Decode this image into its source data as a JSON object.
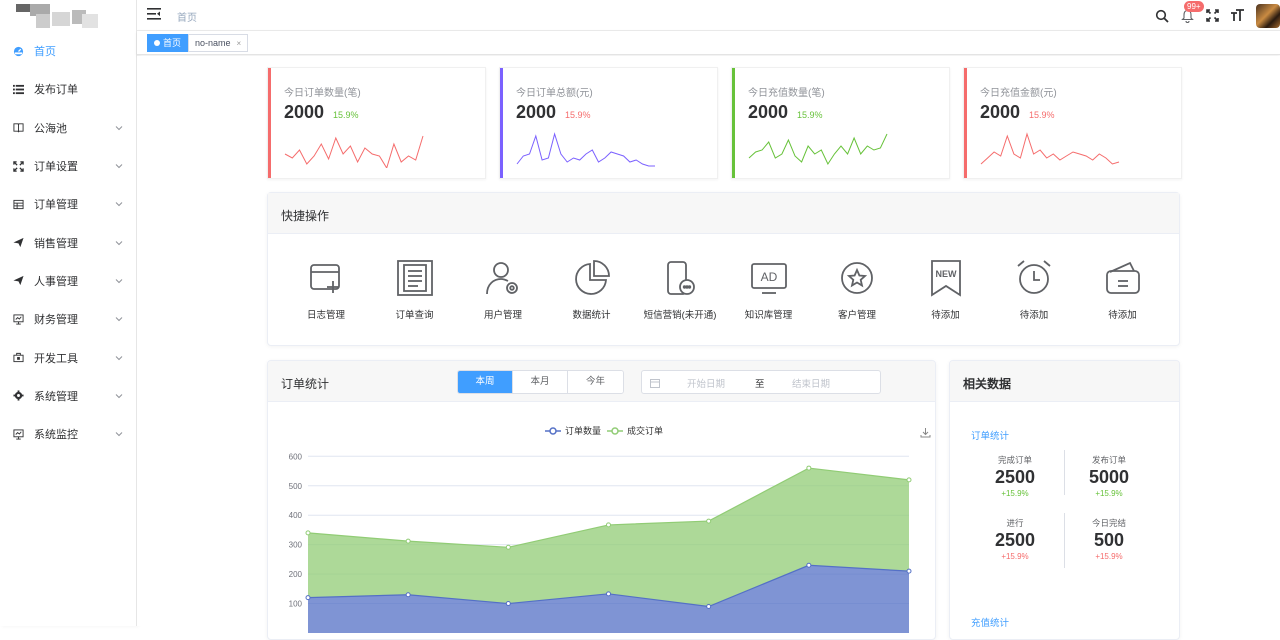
{
  "sidebar": {
    "items": [
      {
        "label": "首页",
        "icon": "dashboard-icon",
        "active": true,
        "has_children": false
      },
      {
        "label": "发布订单",
        "icon": "list-icon",
        "active": false,
        "has_children": false
      },
      {
        "label": "公海池",
        "icon": "book-icon",
        "active": false,
        "has_children": true
      },
      {
        "label": "订单设置",
        "icon": "fullscreen-icon",
        "active": false,
        "has_children": true
      },
      {
        "label": "订单管理",
        "icon": "table-icon",
        "active": false,
        "has_children": true
      },
      {
        "label": "销售管理",
        "icon": "send-icon",
        "active": false,
        "has_children": true
      },
      {
        "label": "人事管理",
        "icon": "send-icon",
        "active": false,
        "has_children": true
      },
      {
        "label": "财务管理",
        "icon": "monitor-chart-icon",
        "active": false,
        "has_children": true
      },
      {
        "label": "开发工具",
        "icon": "toolbox-icon",
        "active": false,
        "has_children": true
      },
      {
        "label": "系统管理",
        "icon": "gear-icon",
        "active": false,
        "has_children": true
      },
      {
        "label": "系统监控",
        "icon": "monitor-icon",
        "active": false,
        "has_children": true
      }
    ]
  },
  "header": {
    "breadcrumb": "首页",
    "notification_badge": "99+"
  },
  "tags": {
    "active_label": "首页",
    "second_label": "no-name",
    "close_glyph": "×"
  },
  "stats": [
    {
      "title": "今日订单数量(笔)",
      "value": "2000",
      "pct": "15.9%",
      "bar_color": "#f56c6c",
      "pct_color": "#67c23a",
      "spark_color": "#f56c6c",
      "spark": [
        30,
        34,
        26,
        40,
        32,
        20,
        35,
        14,
        30,
        22,
        38,
        24,
        30,
        32,
        44,
        20,
        38,
        32,
        36,
        12
      ]
    },
    {
      "title": "今日订单总额(元)",
      "value": "2000",
      "pct": "15.9%",
      "bar_color": "#7b61ff",
      "pct_color": "#f56c6c",
      "spark_color": "#7b61ff",
      "spark": [
        40,
        32,
        30,
        12,
        36,
        34,
        10,
        30,
        38,
        34,
        36,
        30,
        26,
        38,
        34,
        28,
        30,
        32,
        38,
        36,
        40,
        42,
        42
      ]
    },
    {
      "title": "今日充值数量(笔)",
      "value": "2000",
      "pct": "15.9%",
      "bar_color": "#67c23a",
      "pct_color": "#67c23a",
      "spark_color": "#67c23a",
      "spark": [
        34,
        28,
        26,
        18,
        34,
        30,
        16,
        32,
        38,
        22,
        30,
        26,
        40,
        30,
        22,
        30,
        14,
        30,
        22,
        26,
        24,
        10
      ]
    },
    {
      "title": "今日充值金额(元)",
      "value": "2000",
      "pct": "15.9%",
      "bar_color": "#f56c6c",
      "pct_color": "#f56c6c",
      "spark_color": "#f56c6c",
      "spark": [
        40,
        34,
        28,
        32,
        12,
        30,
        34,
        10,
        30,
        26,
        34,
        30,
        36,
        32,
        28,
        30,
        32,
        36,
        30,
        34,
        40,
        38
      ]
    }
  ],
  "quick": {
    "title": "快捷操作",
    "items": [
      {
        "label": "日志管理",
        "icon": "log-add-icon"
      },
      {
        "label": "订单查询",
        "icon": "document-list-icon"
      },
      {
        "label": "用户管理",
        "icon": "user-settings-icon"
      },
      {
        "label": "数据统计",
        "icon": "pie-chart-icon"
      },
      {
        "label": "短信营销(未开通)",
        "icon": "sms-phone-icon"
      },
      {
        "label": "知识库管理",
        "icon": "ad-monitor-icon"
      },
      {
        "label": "客户管理",
        "icon": "star-badge-icon"
      },
      {
        "label": "待添加",
        "icon": "new-ribbon-icon"
      },
      {
        "label": "待添加",
        "icon": "alarm-clock-icon"
      },
      {
        "label": "待添加",
        "icon": "wallet-icon"
      }
    ]
  },
  "orders_panel": {
    "title": "订单统计",
    "segments": [
      "本周",
      "本月",
      "今年"
    ],
    "active_segment": 0,
    "date_start_placeholder": "开始日期",
    "date_sep": "至",
    "date_end_placeholder": "结束日期"
  },
  "chart_data": {
    "type": "area",
    "legend_position": "top-center",
    "stacked": true,
    "series": [
      {
        "name": "订单数量",
        "color": "#5470c6",
        "values": [
          120,
          130,
          100,
          133,
          90,
          230,
          210
        ]
      },
      {
        "name": "成交订单",
        "color": "#91cc75",
        "values": [
          220,
          182,
          191,
          234,
          290,
          330,
          310
        ]
      }
    ],
    "y_ticks": [
      100,
      200,
      300,
      400,
      500,
      600
    ],
    "ylim": [
      0,
      650
    ],
    "grid": true
  },
  "related": {
    "title": "相关数据",
    "section1": "订单统计",
    "section2": "充值统计",
    "items": [
      {
        "label": "完成订单",
        "value": "2500",
        "pct": "+15.9%",
        "pct_color": "#67c23a"
      },
      {
        "label": "发布订单",
        "value": "5000",
        "pct": "+15.9%",
        "pct_color": "#67c23a"
      },
      {
        "label": "进行",
        "value": "2500",
        "pct": "+15.9%",
        "pct_color": "#f56c6c"
      },
      {
        "label": "今日完结",
        "value": "500",
        "pct": "+15.9%",
        "pct_color": "#f56c6c"
      }
    ]
  }
}
